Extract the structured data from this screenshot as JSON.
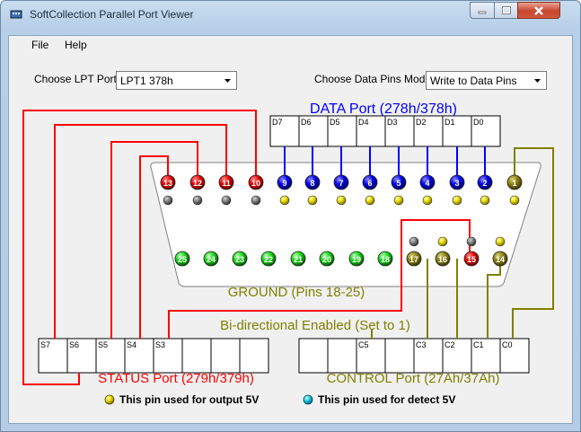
{
  "window": {
    "title": "SoftCollection Parallel Port Viewer"
  },
  "menu": [
    "File",
    "Help"
  ],
  "controls": {
    "lpt_label": "Choose LPT Port",
    "lpt_value": "LPT1 378h",
    "mode_label": "Choose Data Pins Mode",
    "mode_value": "Write to Data Pins"
  },
  "colors": {
    "data": "#0000ff",
    "status": "#ff0000",
    "control": "#808000",
    "ground": "#00c000",
    "output_led": "#e6d800",
    "detect_led": "#24c8e6"
  },
  "data_port": {
    "title": "DATA Port (278h/378h)",
    "bits": [
      "D7",
      "D6",
      "D5",
      "D4",
      "D3",
      "D2",
      "D1",
      "D0"
    ]
  },
  "status_port": {
    "title": "STATUS Port (279h/379h)",
    "bits": [
      "S7",
      "S6",
      "S5",
      "S4",
      "S3",
      "",
      "",
      ""
    ]
  },
  "control_port": {
    "title": "CONTROL Port (27Ah/37Ah)",
    "bits": [
      "",
      "",
      "C5",
      "",
      "C3",
      "C2",
      "C1",
      "C0"
    ]
  },
  "connector": {
    "top_row": [
      {
        "pin": "13",
        "type": "status"
      },
      {
        "pin": "12",
        "type": "status"
      },
      {
        "pin": "11",
        "type": "status"
      },
      {
        "pin": "10",
        "type": "status"
      },
      {
        "pin": "9",
        "type": "data"
      },
      {
        "pin": "8",
        "type": "data"
      },
      {
        "pin": "7",
        "type": "data"
      },
      {
        "pin": "6",
        "type": "data"
      },
      {
        "pin": "5",
        "type": "data"
      },
      {
        "pin": "4",
        "type": "data"
      },
      {
        "pin": "3",
        "type": "data"
      },
      {
        "pin": "2",
        "type": "data"
      },
      {
        "pin": "1",
        "type": "control"
      }
    ],
    "bottom_row": [
      {
        "pin": "25",
        "type": "ground"
      },
      {
        "pin": "24",
        "type": "ground"
      },
      {
        "pin": "23",
        "type": "ground"
      },
      {
        "pin": "22",
        "type": "ground"
      },
      {
        "pin": "21",
        "type": "ground"
      },
      {
        "pin": "20",
        "type": "ground"
      },
      {
        "pin": "19",
        "type": "ground"
      },
      {
        "pin": "18",
        "type": "ground"
      },
      {
        "pin": "17",
        "type": "control"
      },
      {
        "pin": "16",
        "type": "control"
      },
      {
        "pin": "15",
        "type": "status"
      },
      {
        "pin": "14",
        "type": "control"
      }
    ],
    "ground_label": "GROUND (Pins 18-25)",
    "bidir_label": "Bi-directional Enabled (Set to 1)"
  },
  "legend": {
    "output": "This pin used for output 5V",
    "detect": "This pin used for detect 5V"
  }
}
